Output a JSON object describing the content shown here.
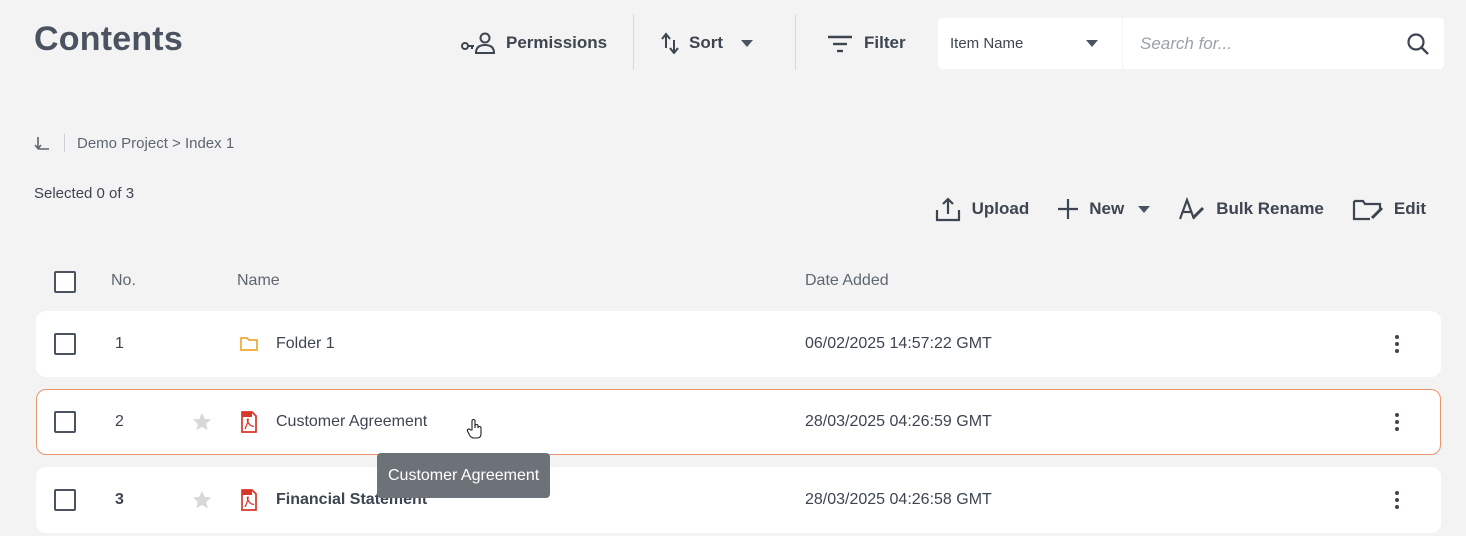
{
  "header": {
    "title": "Contents",
    "permissions_label": "Permissions",
    "sort_label": "Sort",
    "filter_label": "Filter",
    "filter_field_value": "Item Name",
    "search_placeholder": "Search for..."
  },
  "breadcrumb": {
    "path": "Demo Project > Index 1"
  },
  "selection": {
    "text": "Selected 0 of 3"
  },
  "actions": {
    "upload_label": "Upload",
    "new_label": "New",
    "bulk_rename_label": "Bulk Rename",
    "edit_label": "Edit"
  },
  "table": {
    "columns": {
      "no": "No.",
      "name": "Name",
      "date": "Date Added"
    },
    "rows": [
      {
        "no": "1",
        "name": "Folder 1",
        "type_icon": "folder-icon",
        "date": "06/02/2025 14:57:22 GMT"
      },
      {
        "no": "2",
        "name": "Customer Agreement",
        "type_icon": "pdf-file-icon",
        "date": "28/03/2025 04:26:59 GMT"
      },
      {
        "no": "3",
        "name": "Financial Statement",
        "type_icon": "pdf-file-icon",
        "date": "28/03/2025 04:26:58 GMT"
      }
    ]
  },
  "tooltip": {
    "text": "Customer Agreement"
  },
  "colors": {
    "accent_hover_border": "#e8956b",
    "pdf_red": "#d9352b",
    "folder_orange": "#f0a832",
    "text": "#3d4550"
  }
}
